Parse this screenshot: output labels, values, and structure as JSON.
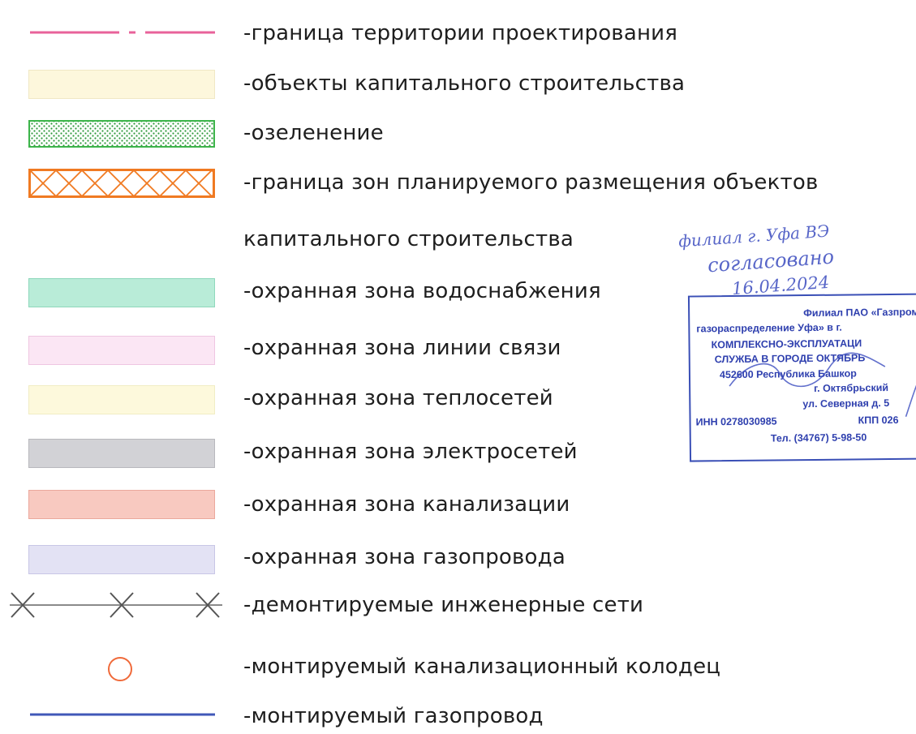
{
  "legend": {
    "items": [
      {
        "id": "border",
        "text": "-граница территории проектирования"
      },
      {
        "id": "capital",
        "text": "-объекты капитального строительства"
      },
      {
        "id": "green",
        "text": "-озеленение"
      },
      {
        "id": "zones",
        "text": "-граница зон планируемого размещения объектов",
        "text2": "капитального строительства"
      },
      {
        "id": "water",
        "text": "-охранная зона водоснабжения"
      },
      {
        "id": "comm",
        "text": "-охранная зона линии связи"
      },
      {
        "id": "heat",
        "text": "-охранная зона теплосетей"
      },
      {
        "id": "power",
        "text": "-охранная зона электросетей"
      },
      {
        "id": "sewer",
        "text": "-охранная зона канализации"
      },
      {
        "id": "gas",
        "text": "-охранная зона газопровода"
      },
      {
        "id": "dismantled",
        "text": "-демонтируемые инженерные сети"
      },
      {
        "id": "well",
        "text": "-монтируемый канализационный колодец"
      },
      {
        "id": "gaspipe",
        "text": "-монтируемый газопровод"
      }
    ],
    "colors": {
      "border_line": "#e8629a",
      "capital": "#fdf7dc",
      "green_border": "#3cb44a",
      "green_dots": "#2f9a3c",
      "zones_border": "#f07a22",
      "water": "#b9ecd8",
      "comm": "#fbe6f4",
      "heat": "#fdf9dc",
      "power": "#d2d2d6",
      "sewer": "#f8c9c0",
      "gas": "#e3e2f4",
      "dismantled": "#6f6f6f",
      "well": "#f06a3a",
      "gaspipe": "#4058b8"
    }
  },
  "stamp": {
    "lines": [
      "Филиал ПАО «Газпром»",
      "газораспределение Уфа» в г.",
      "КОМПЛЕКСНО-ЭКСПЛУАТАЦИ",
      "СЛУЖБА В ГОРОДЕ ОКТЯБРЬ",
      "452600 Республика Башкор",
      "г. Октябрьский",
      "ул. Северная д. 5",
      "ИНН 0278030985",
      "КПП 026",
      "Тел. (34767) 5-98-50"
    ],
    "handwriting": [
      "филиал г. Уфа ВЭ",
      "согласовано",
      "16.04.2024"
    ]
  }
}
